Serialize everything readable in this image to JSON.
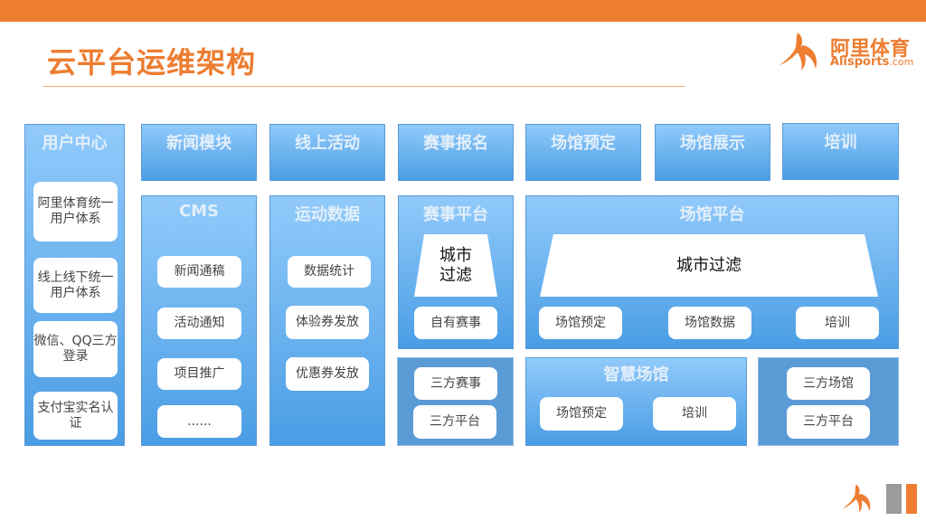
{
  "title": "云平台运维架构",
  "logo": {
    "cn": "阿里体育",
    "en": "Alisports",
    "dot": ".com"
  },
  "top_row": [
    "新闻模块",
    "线上活动",
    "赛事报名",
    "场馆预定",
    "场馆展示",
    "培训"
  ],
  "user_center": {
    "title": "用户中心",
    "items": [
      "阿里体育统一用户体系",
      "线上线下统一用户体系",
      "微信、QQ三方登录",
      "支付宝实名认证"
    ]
  },
  "cms": {
    "title": "CMS",
    "items": [
      "新闻通稿",
      "活动通知",
      "项目推广",
      "......"
    ]
  },
  "sports_data": {
    "title": "运动数据",
    "items": [
      "数据统计",
      "体验券发放",
      "优惠券发放"
    ]
  },
  "event_platform": {
    "title": "赛事平台",
    "filter": "城市过滤",
    "items": [
      "自有赛事"
    ]
  },
  "venue_platform": {
    "title": "场馆平台",
    "filter": "城市过滤",
    "items": [
      "场馆预定",
      "场馆数据",
      "培训"
    ]
  },
  "third_event": {
    "items": [
      "三方赛事",
      "三方平台"
    ]
  },
  "smart_venue": {
    "title": "智慧场馆",
    "items": [
      "场馆预定",
      "培训"
    ]
  },
  "third_venue": {
    "items": [
      "三方场馆",
      "三方平台"
    ]
  },
  "colors": {
    "accent": "#ED7D31",
    "blue": "#5B9BD5"
  }
}
